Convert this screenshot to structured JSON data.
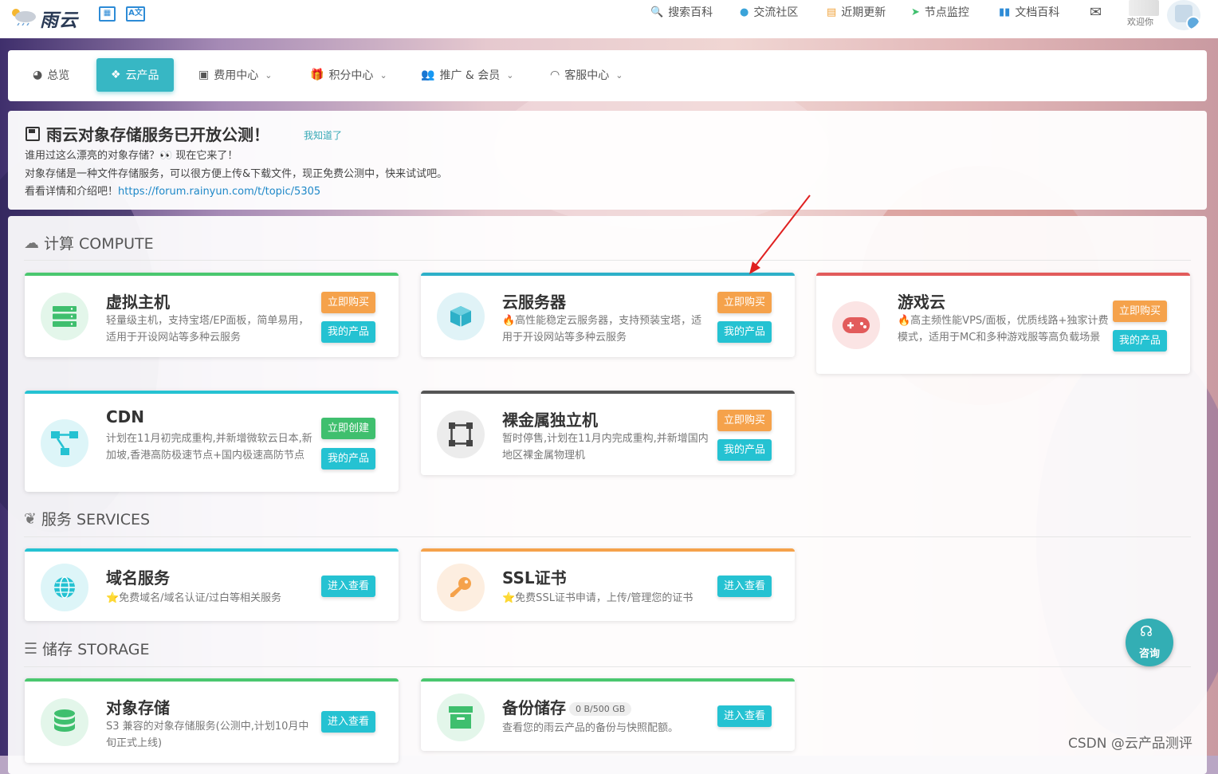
{
  "brand": {
    "logo_text": "雨云"
  },
  "top_nav": [
    {
      "label": "搜索百科",
      "icon": "search-icon"
    },
    {
      "label": "交流社区",
      "icon": "bell-icon"
    },
    {
      "label": "近期更新",
      "icon": "news-icon"
    },
    {
      "label": "节点监控",
      "icon": "send-icon"
    },
    {
      "label": "文档百科",
      "icon": "book-icon"
    }
  ],
  "user": {
    "welcome": "欢迎你"
  },
  "menu": [
    {
      "label": "总览",
      "icon": "dashboard-icon"
    },
    {
      "label": "云产品",
      "icon": "cubes-icon"
    },
    {
      "label": "费用中心",
      "icon": "money-icon"
    },
    {
      "label": "积分中心",
      "icon": "gift-icon"
    },
    {
      "label": "推广 & 会员",
      "icon": "users-icon"
    },
    {
      "label": "客服中心",
      "icon": "headset-icon"
    }
  ],
  "notice": {
    "title": "雨云对象存储服务已开放公测！",
    "ack": "我知道了",
    "line1": "谁用过这么漂亮的对象存储？👀 现在它来了！",
    "line2": "对象存储是一种文件存储服务，可以很方便上传&下载文件，现正免费公测中，快来试试吧。",
    "line3_prefix": "看看详情和介绍吧！",
    "link": "https://forum.rainyun.com/t/topic/5305"
  },
  "sections": {
    "compute": "计算 COMPUTE",
    "services": "服务 SERVICES",
    "storage": "储存 STORAGE"
  },
  "cards": {
    "vhost": {
      "title": "虚拟主机",
      "desc": "轻量级主机，支持宝塔/EP面板，简单易用，适用于开设网站等多种云服务",
      "buy": "立即购买",
      "mine": "我的产品"
    },
    "cvm": {
      "title": "云服务器",
      "desc": "🔥高性能稳定云服务器，支持预装宝塔，适用于开设网站等多种云服务",
      "buy": "立即购买",
      "mine": "我的产品"
    },
    "game": {
      "title": "游戏云",
      "desc": "🔥高主频性能VPS/面板，优质线路+独家计费模式，适用于MC和多种游戏服等高负载场景",
      "buy": "立即购买",
      "mine": "我的产品"
    },
    "cdn": {
      "title": "CDN",
      "desc": "计划在11月初完成重构,并新增微软云日本,新加坡,香港高防极速节点+国内极速高防节点",
      "create": "立即创建",
      "mine": "我的产品"
    },
    "bare": {
      "title": "裸金属独立机",
      "desc": "暂时停售,计划在11月内完成重构,并新增国内地区裸金属物理机",
      "buy": "立即购买",
      "mine": "我的产品"
    },
    "domain": {
      "title": "域名服务",
      "desc": "⭐免费域名/域名认证/过白等相关服务",
      "enter": "进入查看"
    },
    "ssl": {
      "title": "SSL证书",
      "desc": "⭐免费SSL证书申请，上传/管理您的证书",
      "enter": "进入查看"
    },
    "oss": {
      "title": "对象存储",
      "desc": "S3 兼容的对象存储服务(公测中,计划10月中旬正式上线)",
      "enter": "进入查看"
    },
    "backup": {
      "title": "备份储存",
      "badge": "0 B/500 GB",
      "desc": "查看您的雨云产品的备份与快照配额。",
      "enter": "进入查看"
    }
  },
  "consult": {
    "label": "咨询"
  },
  "watermark": "CSDN @云产品测评",
  "colors": {
    "accent": "#37b7c4",
    "buy": "#f5a24b",
    "mine": "#25c2d2",
    "create": "#3fbf6e"
  }
}
